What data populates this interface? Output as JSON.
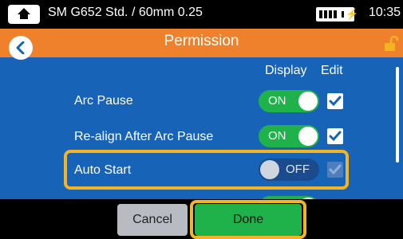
{
  "status_bar": {
    "title": "SM G652 Std. / 60mm 0.25",
    "time": "10:35",
    "home_icon": "home-icon",
    "battery_icon": "battery-charging-icon"
  },
  "header": {
    "title": "Permission",
    "back_icon": "chevron-left-icon",
    "lock_icon": "unlock-icon",
    "accent_color": "#f0812c"
  },
  "columns": {
    "display": "Display",
    "edit": "Edit"
  },
  "rows": [
    {
      "label": "Arc Pause",
      "toggle": "ON",
      "toggle_state": true,
      "edit_checked": true
    },
    {
      "label": "Re-align After Arc Pause",
      "toggle": "ON",
      "toggle_state": true,
      "edit_checked": true
    },
    {
      "label": "Auto Start",
      "toggle": "OFF",
      "toggle_state": false,
      "edit_checked": true
    }
  ],
  "footer": {
    "cancel": "Cancel",
    "done": "Done"
  },
  "colors": {
    "background": "#1763b8",
    "toggle_on": "#20b24a",
    "highlight": "#f4b322"
  }
}
